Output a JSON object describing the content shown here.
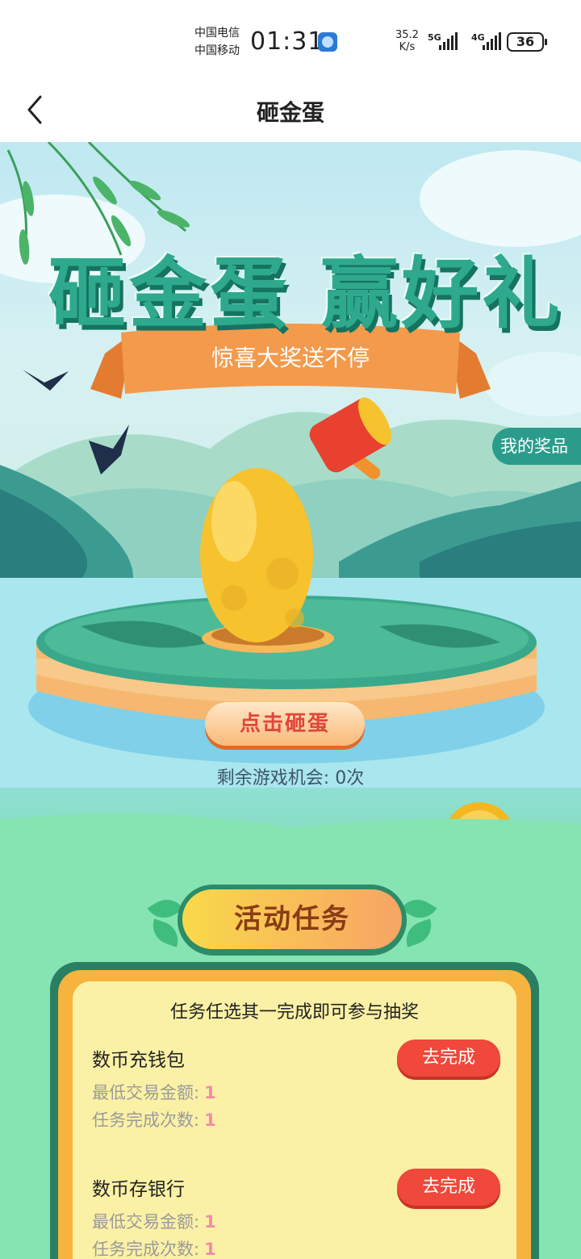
{
  "status_bar": {
    "carrier_1": "中国电信",
    "carrier_2": "中国移动",
    "time": "01:31",
    "net_speed_value": "35.2",
    "net_speed_unit": "K/s",
    "signal_1_label": "5G",
    "signal_2_label": "4G",
    "battery": "36"
  },
  "nav": {
    "title": "砸金蛋",
    "back_icon": "chevron-left-icon"
  },
  "hero": {
    "headline": "砸金蛋 赢好礼",
    "ribbon_text": "惊喜大奖送不停",
    "my_prizes_label": "我的奖品",
    "smash_button_label": "点击砸蛋",
    "chances_label": "剩余游戏机会:",
    "chances_value": "0次",
    "colors": {
      "egg": "#f6c22e",
      "hammer_head": "#e8412f",
      "ribbon": "#f39a4c",
      "headline": "#2ea98d"
    }
  },
  "tasks": {
    "section_title": "活动任务",
    "note": "任务任选其一完成即可参与抽奖",
    "items": [
      {
        "name": "数币充钱包",
        "min_amount_label": "最低交易金额:",
        "min_amount_value": "1",
        "count_label": "任务完成次数:",
        "count_value": "1",
        "button_label": "去完成"
      },
      {
        "name": "数币存银行",
        "min_amount_label": "最低交易金额:",
        "min_amount_value": "1",
        "count_label": "任务完成次数:",
        "count_value": "1",
        "button_label": "去完成"
      }
    ]
  }
}
